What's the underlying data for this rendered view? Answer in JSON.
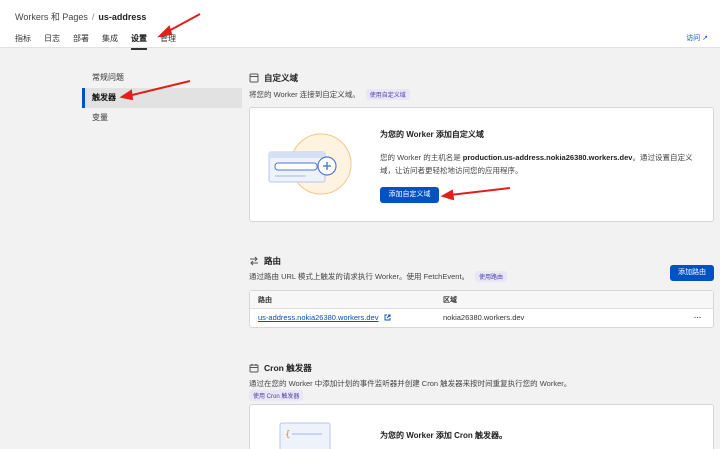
{
  "header": {
    "breadcrumb_root": "Workers 和 Pages",
    "breadcrumb_sep": "/",
    "breadcrumb_current": "us-address",
    "tabs": [
      {
        "label": "指标"
      },
      {
        "label": "日志"
      },
      {
        "label": "部署"
      },
      {
        "label": "集成"
      },
      {
        "label": "设置"
      },
      {
        "label": "管理"
      }
    ],
    "active_tab": "设置",
    "visit_label": "访问 ↗"
  },
  "sidebar": {
    "items": [
      {
        "label": "常规问题"
      },
      {
        "label": "触发器"
      },
      {
        "label": "变量"
      }
    ],
    "active": "触发器"
  },
  "custom_domains": {
    "title": "自定义域",
    "desc": "将您的 Worker 连接到自定义域。",
    "doc_label": "使用自定义域",
    "card_title": "为您的 Worker 添加自定义域",
    "card_text_pre": "您的 Worker 的主机名是",
    "hostname": "production.us-address.nokia26380.workers.dev",
    "card_text_post": "。通过设置自定义域，让访问者更轻松地访问您的应用程序。",
    "button_label": "添加自定义域"
  },
  "routes": {
    "title": "路由",
    "desc": "通过路由 URL 模式上触发的请求执行 Worker。使用 FetchEvent。",
    "doc_label": "使用路由",
    "button_label": "添加路由",
    "columns": [
      "路由",
      "区域"
    ],
    "rows": [
      {
        "route": "us-address.nokia26380.workers.dev",
        "zone": "nokia26380.workers.dev"
      }
    ],
    "more_label": "···"
  },
  "cron": {
    "title": "Cron 触发器",
    "desc": "通过在您的 Worker 中添加计划的事件监听器并创建 Cron 触发器来按时间重复执行您的 Worker。",
    "doc_label": "使用 Cron 触发器",
    "card_title": "为您的 Worker 添加 Cron 触发器。"
  },
  "colors": {
    "accent": "#0051c3",
    "annotation_arrow": "#e0201b"
  }
}
